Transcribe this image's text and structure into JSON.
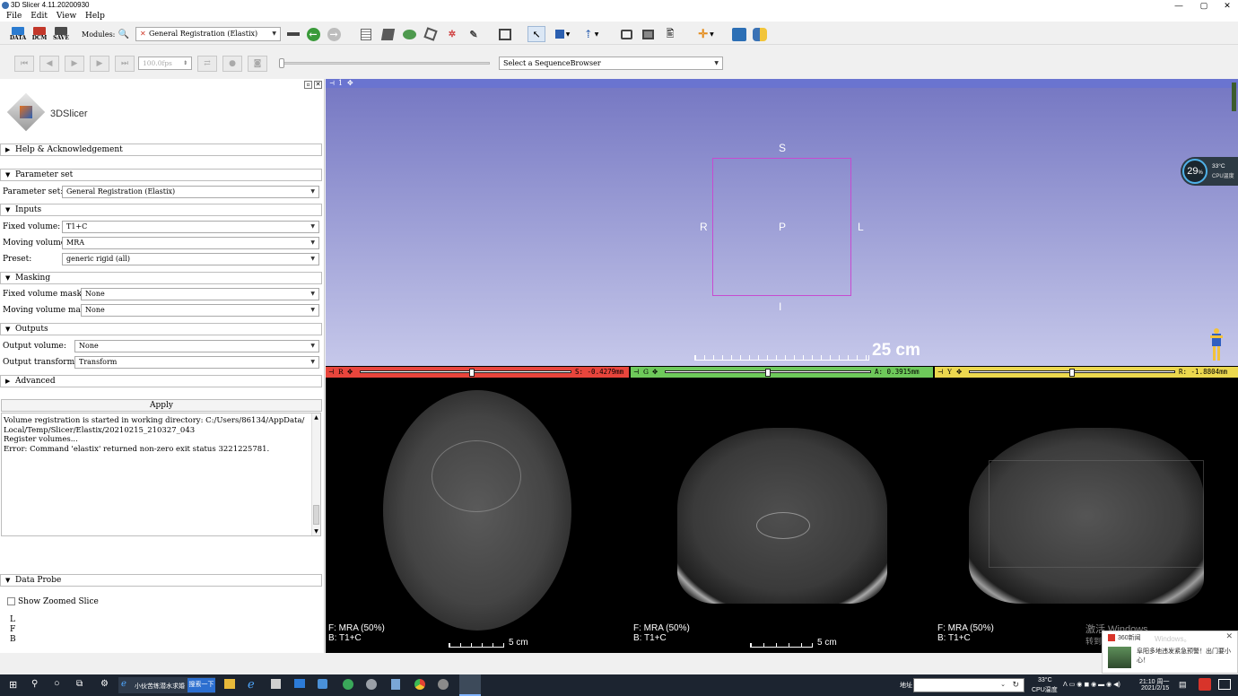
{
  "window": {
    "title": "3D Slicer 4.11.20200930",
    "controls": [
      "—",
      "▢",
      "✕"
    ]
  },
  "menu": [
    "File",
    "Edit",
    "View",
    "Help"
  ],
  "toolbar": {
    "data_label": "DATA",
    "dcm_label": "DCM",
    "save_label": "SAVE",
    "modules_label": "Modules:",
    "module_selected": "General Registration (Elastix)"
  },
  "sequence": {
    "fps": "100.0fps",
    "browser_placeholder": "Select a SequenceBrowser"
  },
  "logo": {
    "text": "3DSlicer"
  },
  "sections": {
    "help": "Help & Acknowledgement",
    "parameter_set": "Parameter set",
    "inputs": "Inputs",
    "masking": "Masking",
    "outputs": "Outputs",
    "advanced": "Advanced",
    "data_probe": "Data Probe"
  },
  "form": {
    "parameter_set_label": "Parameter set:",
    "parameter_set_value": "General Registration (Elastix)",
    "fixed_volume_label": "Fixed volume:",
    "fixed_volume_value": "T1+C",
    "moving_volume_label": "Moving volume:",
    "moving_volume_value": "MRA",
    "preset_label": "Preset:",
    "preset_value": "generic rigid (all)",
    "fixed_mask_label": "Fixed volume mask:",
    "fixed_mask_value": "None",
    "moving_mask_label": "Moving volume mask:",
    "moving_mask_value": "None",
    "output_volume_label": "Output volume:",
    "output_volume_value": "None",
    "output_transform_label": "Output transform:",
    "output_transform_value": "Transform"
  },
  "apply_label": "Apply",
  "console": [
    "Volume registration is started in working directory: C:/Users/86134/AppData/",
    "Local/Temp/Slicer/Elastix/20210215_210327_043",
    "Register volumes...",
    "Error: Command 'elastix' returned non-zero exit status 3221225781."
  ],
  "data_probe": {
    "zoom_label": "Show Zoomed Slice",
    "L": "L",
    "F": "F",
    "B": "B"
  },
  "view3d": {
    "tab": "1",
    "S": "S",
    "I": "I",
    "R": "R",
    "L": "L",
    "P": "P",
    "scale": "25 cm"
  },
  "cpu_widget": {
    "percent": "29",
    "unit": "%",
    "temp": "33°C",
    "label": "CPU温度"
  },
  "slices": [
    {
      "letter": "R",
      "offset": "S: -0.4279mm",
      "fg": "F: MRA (50%)",
      "bg": "B: T1+C",
      "scale": "5 cm",
      "color": "#e8453c",
      "position": 0.53
    },
    {
      "letter": "G",
      "offset": "A: 0.3915mm",
      "fg": "F: MRA (50%)",
      "bg": "B: T1+C",
      "scale": "5 cm",
      "color": "#6ec95a",
      "position": 0.5
    },
    {
      "letter": "Y",
      "offset": "R: -1.8804mm",
      "fg": "F: MRA (50%)",
      "bg": "B: T1+C",
      "scale": "",
      "color": "#ecd84e",
      "position": 0.5
    }
  ],
  "watermark": {
    "line1": "激活 Windows",
    "line2": "转到"
  },
  "notification": {
    "app": "360新闻",
    "text": "阜阳多地违发紧急预警！出门要小心！",
    "bg_text": "Windows。"
  },
  "taskbar": {
    "app_label": "小伙苦练潜水求婚",
    "search_btn": "搜索一下",
    "address_label": "地址",
    "temp": "33°C",
    "temp_label": "CPU温度",
    "time": "21:10 周一",
    "date": "2021/2/15"
  }
}
